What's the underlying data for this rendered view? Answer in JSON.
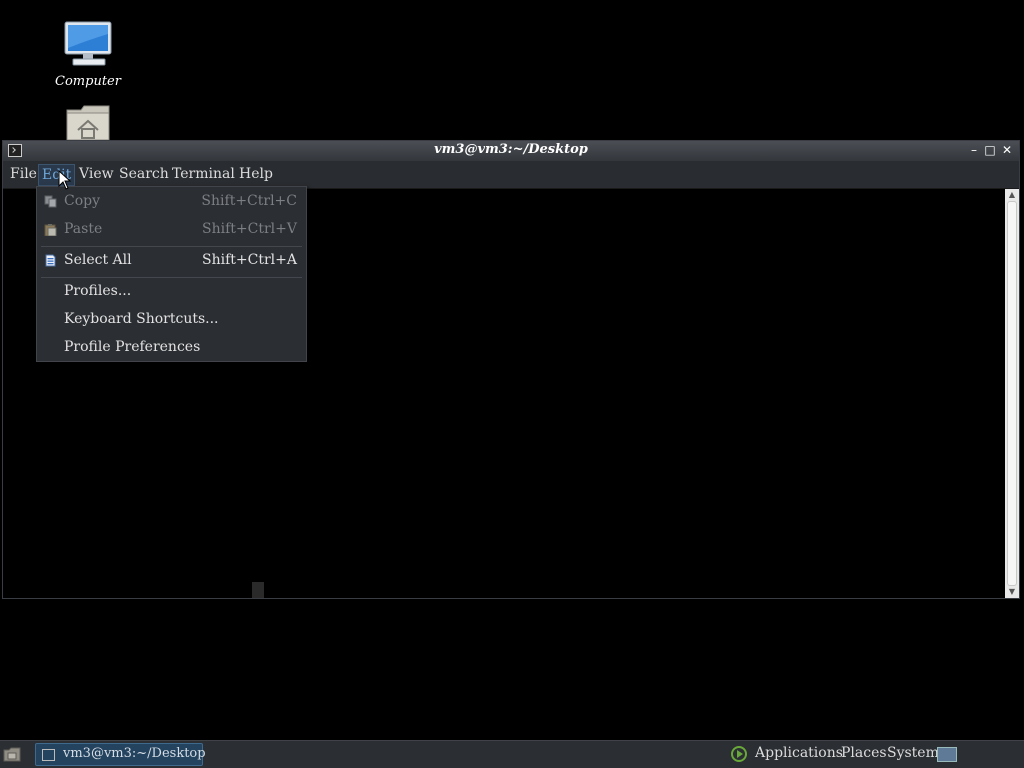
{
  "desktop": {
    "icons": [
      {
        "label": "Computer"
      },
      {
        "label": ""
      }
    ]
  },
  "window": {
    "title": "vm3@vm3:~/Desktop",
    "menubar": [
      "File",
      "Edit",
      "View",
      "Search",
      "Terminal",
      "Help"
    ],
    "active_menu": "Edit"
  },
  "edit_menu": {
    "items": [
      {
        "label": "Copy",
        "shortcut": "Shift+Ctrl+C",
        "enabled": false,
        "icon": "copy-icon"
      },
      {
        "label": "Paste",
        "shortcut": "Shift+Ctrl+V",
        "enabled": false,
        "icon": "paste-icon"
      },
      {
        "label": "Select All",
        "shortcut": "Shift+Ctrl+A",
        "enabled": true,
        "icon": "select-all-icon"
      },
      {
        "label": "Profiles...",
        "shortcut": "",
        "enabled": true
      },
      {
        "label": "Keyboard Shortcuts...",
        "shortcut": "",
        "enabled": true
      },
      {
        "label": "Profile Preferences",
        "shortcut": "",
        "enabled": true
      }
    ]
  },
  "panel": {
    "task_label": "vm3@vm3:~/Desktop",
    "applications": "Applications",
    "places": "Places",
    "system": "System"
  },
  "colors": {
    "panel_bg": "#2b2e33",
    "menu_bg": "#2b2e33",
    "active_menu_text": "#6ea6d8",
    "task_button": "#24435e"
  }
}
